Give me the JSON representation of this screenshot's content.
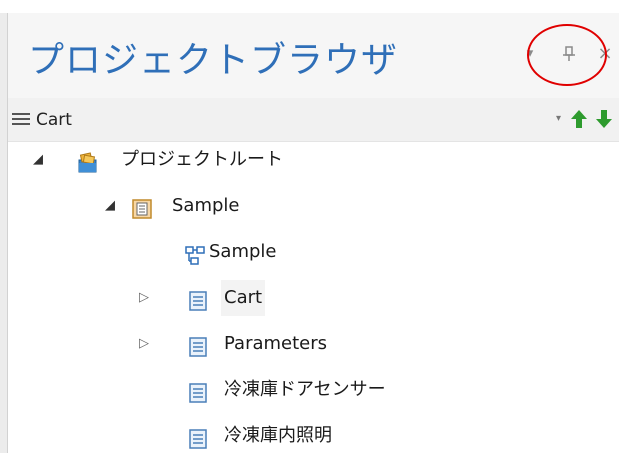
{
  "panel": {
    "title": "プロジェクトブラウザ",
    "buttons": {
      "dropdown": "▾",
      "pin": "Ⴤ",
      "close": "×"
    }
  },
  "toolbar": {
    "menu_icon": "hamburger-icon",
    "current_label": "Cart",
    "dropdown_glyph": "▾"
  },
  "tree": {
    "root": {
      "label": "プロジェクトルート",
      "icon": "project-root-icon",
      "expanded": true
    },
    "package": {
      "label": "Sample",
      "icon": "package-icon",
      "expanded": true
    },
    "children": [
      {
        "label": "Sample",
        "icon": "diagram-icon",
        "expander": "",
        "selected": false
      },
      {
        "label": "Cart",
        "icon": "class-icon",
        "expander": "▷",
        "selected": true
      },
      {
        "label": "Parameters",
        "icon": "class-icon",
        "expander": "▷",
        "selected": false
      },
      {
        "label": "冷凍庫ドアセンサー",
        "icon": "class-icon",
        "expander": "",
        "selected": false
      },
      {
        "label": "冷凍庫内照明",
        "icon": "class-icon",
        "expander": "",
        "selected": false
      }
    ]
  },
  "colors": {
    "title": "#2f6fb8",
    "arrow_up": "#2e9b2e",
    "arrow_down": "#2e9b2e",
    "highlight": "#e00000"
  }
}
